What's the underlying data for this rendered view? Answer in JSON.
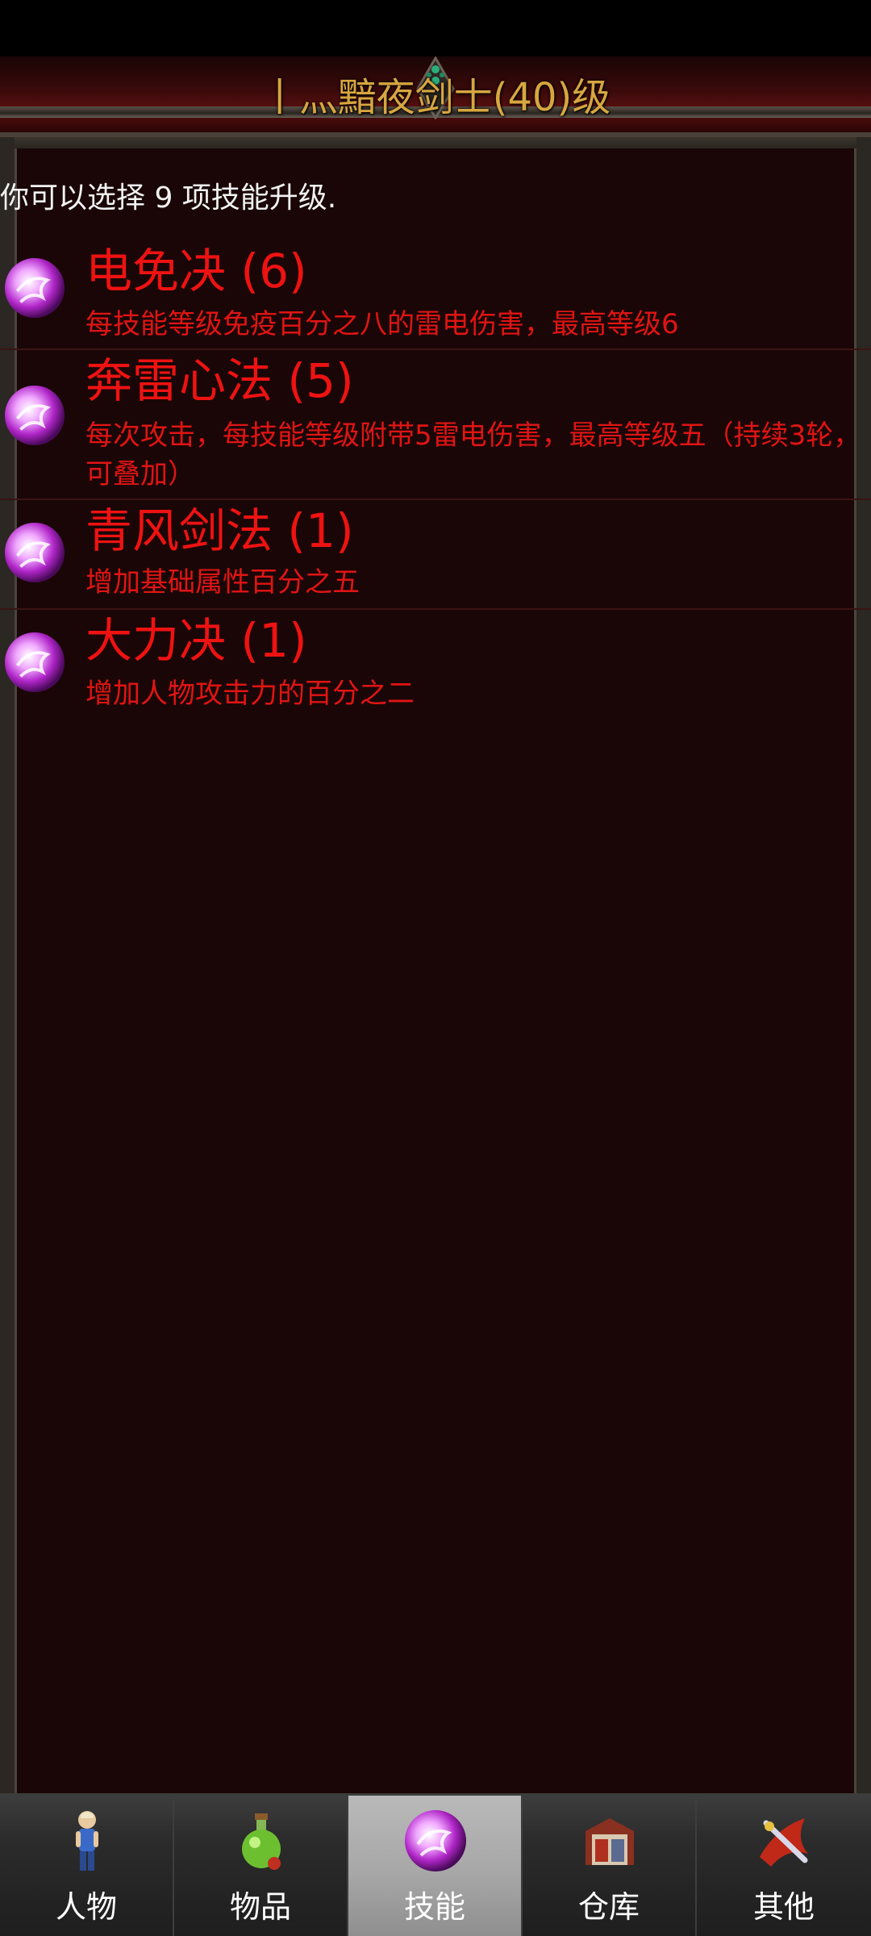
{
  "title": "丨灬黯夜剑士(40)级",
  "notice": "你可以选择 9 项技能升级.",
  "skills": [
    {
      "name": "电免决 (6)",
      "desc": "每技能等级免疫百分之八的雷电伤害，最高等级6",
      "icon": "purple-orb-icon"
    },
    {
      "name": "奔雷心法 (5)",
      "desc": "每次攻击，每技能等级附带5雷电伤害，最高等级五（持续3轮，可叠加）",
      "icon": "purple-orb-icon"
    },
    {
      "name": "青风剑法 (1)",
      "desc": "增加基础属性百分之五",
      "icon": "purple-orb-icon"
    },
    {
      "name": "大力决 (1)",
      "desc": "增加人物攻击力的百分之二",
      "icon": "purple-orb-icon"
    }
  ],
  "tabs": [
    {
      "label": "人物",
      "icon": "character-icon",
      "active": false
    },
    {
      "label": "物品",
      "icon": "potion-icon",
      "active": false
    },
    {
      "label": "技能",
      "icon": "skill-orb-icon",
      "active": true
    },
    {
      "label": "仓库",
      "icon": "warehouse-icon",
      "active": false
    },
    {
      "label": "其他",
      "icon": "other-icon",
      "active": false
    }
  ],
  "colors": {
    "skill_text": "#ef1212",
    "title_gold": "#d8a640",
    "panel_bg": "#1a0606",
    "active_tab": "#a7a7a7"
  }
}
